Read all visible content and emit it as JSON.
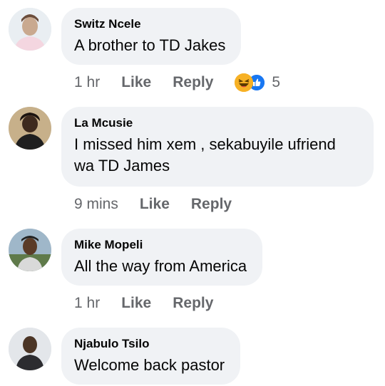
{
  "comments": [
    {
      "author": "Switz Ncele",
      "text": "A brother to TD Jakes",
      "time": "1 hr",
      "like_label": "Like",
      "reply_label": "Reply",
      "reaction_count": "5",
      "reaction_icons": [
        "haha-emoji-icon",
        "like-thumb-icon"
      ]
    },
    {
      "author": "La Mcusie",
      "text": "I missed him xem , sekabuyile ufriend wa TD James",
      "time": "9 mins",
      "like_label": "Like",
      "reply_label": "Reply"
    },
    {
      "author": "Mike Mopeli",
      "text": "All the way from America",
      "time": "1 hr",
      "like_label": "Like",
      "reply_label": "Reply"
    },
    {
      "author": "Njabulo Tsilo",
      "text": "Welcome back pastor"
    }
  ],
  "colors": {
    "bubble_bg": "#f0f2f5",
    "meta_text": "#65676b",
    "haha": "#f7b125",
    "like": "#1877f2"
  }
}
